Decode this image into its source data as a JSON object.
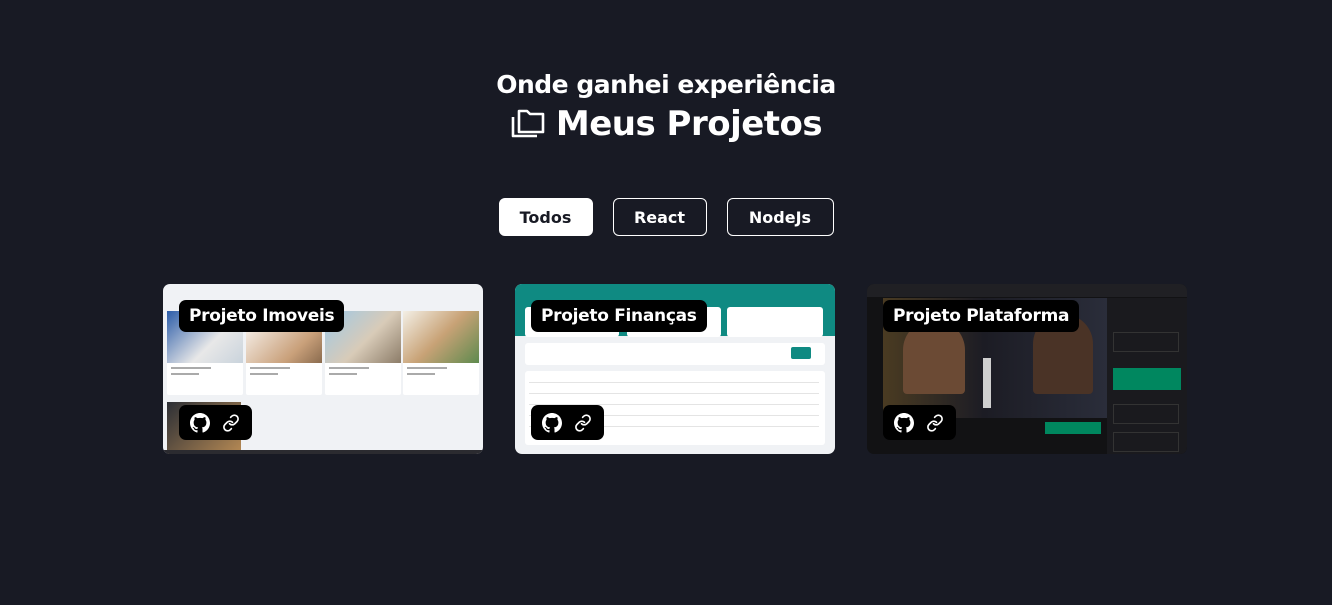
{
  "header": {
    "subtitle": "Onde ganhei experiência",
    "title": "Meus Projetos",
    "title_icon": "folders-icon"
  },
  "filters": [
    {
      "label": "Todos",
      "active": true
    },
    {
      "label": "React",
      "active": false
    },
    {
      "label": "NodeJs",
      "active": false
    }
  ],
  "projects": [
    {
      "title": "Projeto Imoveis",
      "actions": [
        "github-icon",
        "link-icon"
      ]
    },
    {
      "title": "Projeto Finanças",
      "actions": [
        "github-icon",
        "link-icon"
      ]
    },
    {
      "title": "Projeto Plataforma",
      "actions": [
        "github-icon",
        "link-icon"
      ]
    }
  ],
  "colors": {
    "background": "#181a24",
    "text": "#ffffff",
    "label_bg": "#000000",
    "finance_accent": "#0f8a82",
    "ignite_green": "#00875f"
  }
}
